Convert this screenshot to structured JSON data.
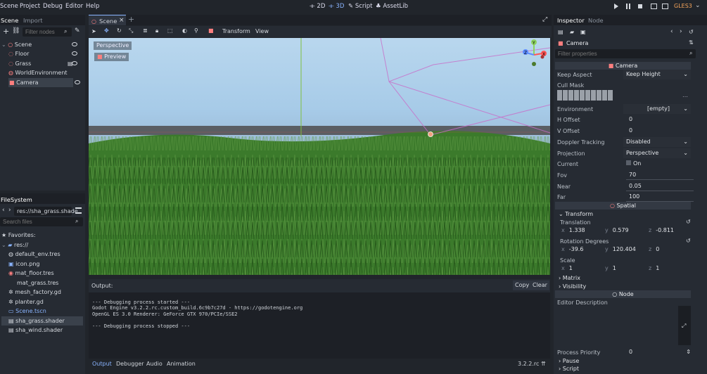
{
  "menu": {
    "scene": "Scene",
    "project": "Project",
    "debug": "Debug",
    "editor": "Editor",
    "help": "Help"
  },
  "modes": {
    "d2": "2D",
    "d3": "3D",
    "script": "Script",
    "assetlib": "AssetLib"
  },
  "renderer": "GLES3",
  "scene_dock": {
    "tab_scene": "Scene",
    "tab_import": "Import",
    "filter_placeholder": "Filter nodes",
    "nodes": [
      {
        "label": "Scene"
      },
      {
        "label": "Floor"
      },
      {
        "label": "Grass"
      },
      {
        "label": "WorldEnvironment"
      },
      {
        "label": "Camera"
      }
    ]
  },
  "filesystem": {
    "title": "FileSystem",
    "path": "res://sha_grass.shade",
    "search_placeholder": "Search files",
    "favorites": "Favorites:",
    "root": "res://",
    "files": [
      {
        "label": "default_env.tres"
      },
      {
        "label": "icon.png"
      },
      {
        "label": "mat_floor.tres"
      },
      {
        "label": "mat_grass.tres"
      },
      {
        "label": "mesh_factory.gd"
      },
      {
        "label": "planter.gd"
      },
      {
        "label": "Scene.tscn"
      },
      {
        "label": "sha_grass.shader"
      },
      {
        "label": "sha_wind.shader"
      }
    ]
  },
  "editor_tabs": {
    "scene_tab": "Scene"
  },
  "viewport_toolbar": {
    "transform": "Transform",
    "view": "View"
  },
  "viewport": {
    "perspective": "Perspective",
    "preview": "Preview"
  },
  "output": {
    "title": "Output:",
    "copy": "Copy",
    "clear": "Clear",
    "lines": [
      "--- Debugging process started ---",
      "Godot Engine v3.2.2.rc.custom_build.6c9b7c27d - https://godotengine.org",
      "OpenGL ES 3.0 Renderer: GeForce GTX 970/PCIe/SSE2",
      "",
      "--- Debugging process stopped ---"
    ]
  },
  "bottom_tabs": {
    "output": "Output",
    "debugger": "Debugger",
    "audio": "Audio",
    "animation": "Animation",
    "version": "3.2.2.rc"
  },
  "inspector": {
    "tab_inspector": "Inspector",
    "tab_node": "Node",
    "object": "Camera",
    "filter_placeholder": "Filter properties",
    "section_camera": "Camera",
    "keep_aspect": {
      "label": "Keep Aspect",
      "value": "Keep Height"
    },
    "cull_mask": {
      "label": "Cull Mask"
    },
    "environment": {
      "label": "Environment",
      "value": "[empty]"
    },
    "h_offset": {
      "label": "H Offset",
      "value": "0"
    },
    "v_offset": {
      "label": "V Offset",
      "value": "0"
    },
    "doppler": {
      "label": "Doppler Tracking",
      "value": "Disabled"
    },
    "projection": {
      "label": "Projection",
      "value": "Perspective"
    },
    "current": {
      "label": "Current",
      "value": "On"
    },
    "fov": {
      "label": "Fov",
      "value": "70"
    },
    "near": {
      "label": "Near",
      "value": "0.05"
    },
    "far": {
      "label": "Far",
      "value": "100"
    },
    "section_spatial": "Spatial",
    "transform": "Transform",
    "translation": {
      "label": "Translation",
      "x": "1.338",
      "y": "0.579",
      "z": "-0.811"
    },
    "rotation": {
      "label": "Rotation Degrees",
      "x": "-39.6",
      "y": "120.404",
      "z": "0"
    },
    "scale": {
      "label": "Scale",
      "x": "1",
      "y": "1",
      "z": "1"
    },
    "matrix": "Matrix",
    "visibility": "Visibility",
    "section_node": "Node",
    "editor_description": "Editor Description",
    "process_priority": {
      "label": "Process Priority",
      "value": "0"
    },
    "pause": "Pause",
    "script": "Script",
    "axis_x": "x",
    "axis_y": "y",
    "axis_z": "z"
  }
}
